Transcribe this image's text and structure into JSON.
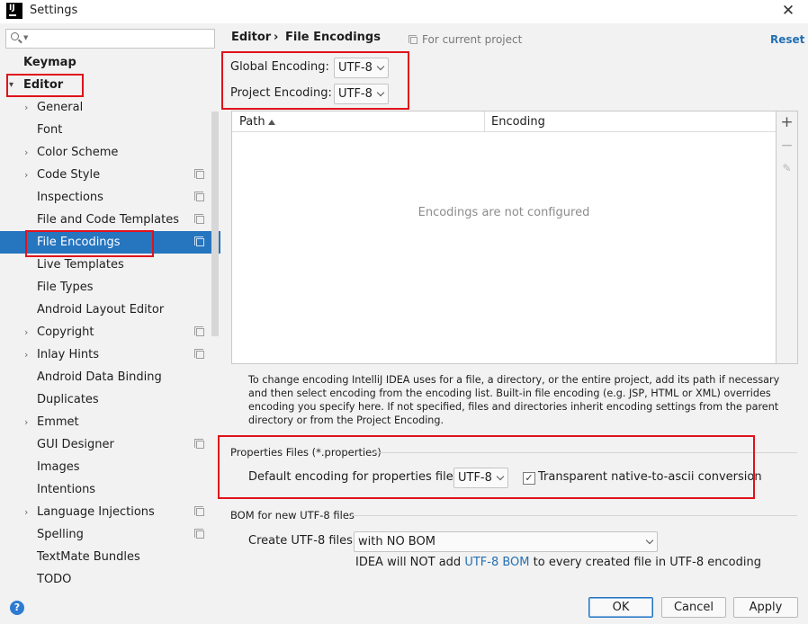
{
  "window": {
    "title": "Settings",
    "app_icon_text": "IJ"
  },
  "sidebar": {
    "search_placeholder": "",
    "items": [
      {
        "label": "Keymap"
      },
      {
        "label": "Editor"
      },
      {
        "label": "General"
      },
      {
        "label": "Font"
      },
      {
        "label": "Color Scheme"
      },
      {
        "label": "Code Style"
      },
      {
        "label": "Inspections"
      },
      {
        "label": "File and Code Templates"
      },
      {
        "label": "File Encodings"
      },
      {
        "label": "Live Templates"
      },
      {
        "label": "File Types"
      },
      {
        "label": "Android Layout Editor"
      },
      {
        "label": "Copyright"
      },
      {
        "label": "Inlay Hints"
      },
      {
        "label": "Android Data Binding"
      },
      {
        "label": "Duplicates"
      },
      {
        "label": "Emmet"
      },
      {
        "label": "GUI Designer"
      },
      {
        "label": "Images"
      },
      {
        "label": "Intentions"
      },
      {
        "label": "Language Injections"
      },
      {
        "label": "Spelling"
      },
      {
        "label": "TextMate Bundles"
      },
      {
        "label": "TODO"
      }
    ]
  },
  "header": {
    "breadcrumb_parent": "Editor",
    "breadcrumb_sep": "›",
    "breadcrumb_current": "File Encodings",
    "scope_text": "For current project",
    "reset_label": "Reset"
  },
  "encodings": {
    "global_label": "Global Encoding:",
    "global_value": "UTF-8",
    "project_label": "Project Encoding:",
    "project_value": "UTF-8"
  },
  "table": {
    "col_path": "Path",
    "col_encoding": "Encoding",
    "empty_text": "Encodings are not configured"
  },
  "help_text": "To change encoding IntelliJ IDEA uses for a file, a directory, or the entire project, add its path if necessary and then select encoding from the encoding list. Built-in file encoding (e.g. JSP, HTML or XML) overrides encoding you specify here. If not specified, files and directories inherit encoding settings from the parent directory or from the Project Encoding.",
  "properties": {
    "section_title": "Properties Files (*.properties)",
    "default_label": "Default encoding for properties files:",
    "default_value": "UTF-8",
    "native_checkbox_label": "Transparent native-to-ascii conversion",
    "native_checked": true
  },
  "bom": {
    "section_title": "BOM for new UTF-8 files",
    "create_label": "Create UTF-8 files:",
    "create_value": "with NO BOM",
    "note_prefix": "IDEA will NOT add ",
    "note_link": "UTF-8 BOM",
    "note_suffix": " to every created file in UTF-8 encoding"
  },
  "footer": {
    "help_icon": "?",
    "ok_label": "OK",
    "cancel_label": "Cancel",
    "apply_label": "Apply"
  },
  "colors": {
    "selection": "#2675bf",
    "highlight_box": "#e0121b",
    "link": "#2470b3"
  }
}
